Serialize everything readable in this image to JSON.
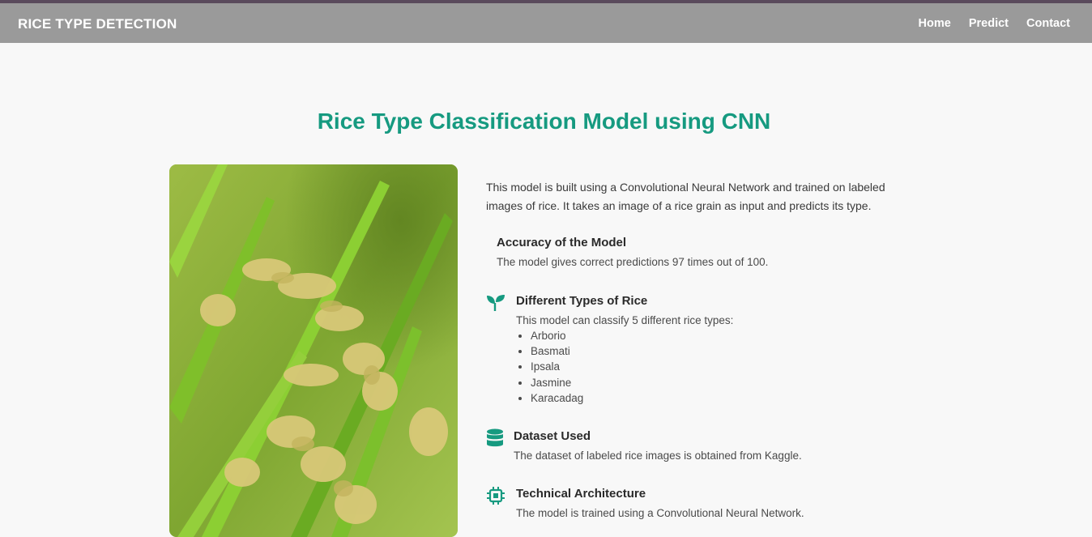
{
  "navbar": {
    "brand": "RICE TYPE DETECTION",
    "links": [
      "Home",
      "Predict",
      "Contact"
    ]
  },
  "main": {
    "title": "Rice Type Classification Model using CNN",
    "image_alt": "rice-plants-photo",
    "intro": "This model is built using a Convolutional Neural Network and trained on labeled images of rice. It takes an image of a rice grain as input and predicts its type.",
    "features": {
      "accuracy": {
        "title": "Accuracy of the Model",
        "text": "The model gives correct predictions 97 times out of 100."
      },
      "types": {
        "title": "Different Types of Rice",
        "text": "This model can classify 5 different rice types:",
        "items": [
          "Arborio",
          "Basmati",
          "Ipsala",
          "Jasmine",
          "Karacadag"
        ]
      },
      "dataset": {
        "title": "Dataset Used",
        "text": "The dataset of labeled rice images is obtained from Kaggle."
      },
      "architecture": {
        "title": "Technical Architecture",
        "text": "The model is trained using a Convolutional Neural Network."
      }
    }
  },
  "colors": {
    "accent": "#169a80",
    "navbar": "#9a9a9a",
    "background": "#f8f8f8"
  }
}
